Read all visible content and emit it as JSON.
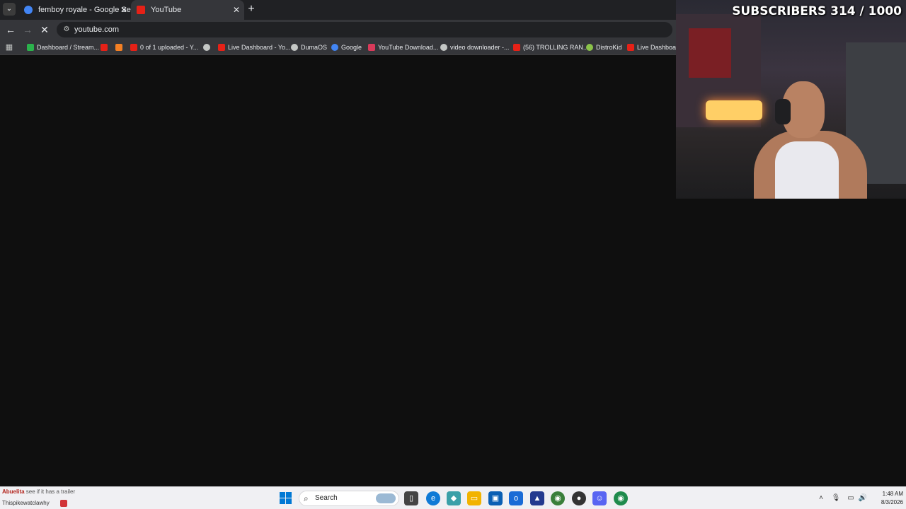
{
  "browser": {
    "tab_menu_icon": "chevron-down-icon",
    "tabs": [
      {
        "label": "femboy royale - Google Search",
        "icon": "google-icon",
        "active": false
      },
      {
        "label": "YouTube",
        "icon": "youtube-icon",
        "active": true
      }
    ],
    "new_tab_icon": "plus-icon",
    "address": "youtube.com",
    "bookmarks": [
      {
        "label": "Dashboard / Stream...",
        "color": "#2bb24c"
      },
      {
        "label": "",
        "color": "#e62117"
      },
      {
        "label": "",
        "color": "#f48024"
      },
      {
        "label": "0 of 1 uploaded - Y...",
        "color": "#e62117"
      },
      {
        "label": "",
        "color": "#c4c7c5"
      },
      {
        "label": "Live Dashboard - Yo...",
        "color": "#e62117"
      },
      {
        "label": "DumaOS",
        "color": "#c4c7c5"
      },
      {
        "label": "Google",
        "color": "#4285f4"
      },
      {
        "label": "YouTube Download...",
        "color": "#d93a5a"
      },
      {
        "label": "video downloader -...",
        "color": "#c4c7c5"
      },
      {
        "label": "(56) TROLLING RAN...",
        "color": "#e62117"
      },
      {
        "label": "DistroKid",
        "color": "#8bc34a"
      },
      {
        "label": "Live Dashboard",
        "color": "#e62117"
      }
    ]
  },
  "overlay": {
    "subscribers_text": "SUBSCRIBERS 314 / 1000"
  },
  "taskbar": {
    "news_line1_prefix": "Abuelita",
    "news_line1": "see if it has a trailer",
    "news_line2": "Thispikewatclawhy",
    "search_label": "Search",
    "time": "1:48 AM",
    "date": "8/3/2026"
  }
}
